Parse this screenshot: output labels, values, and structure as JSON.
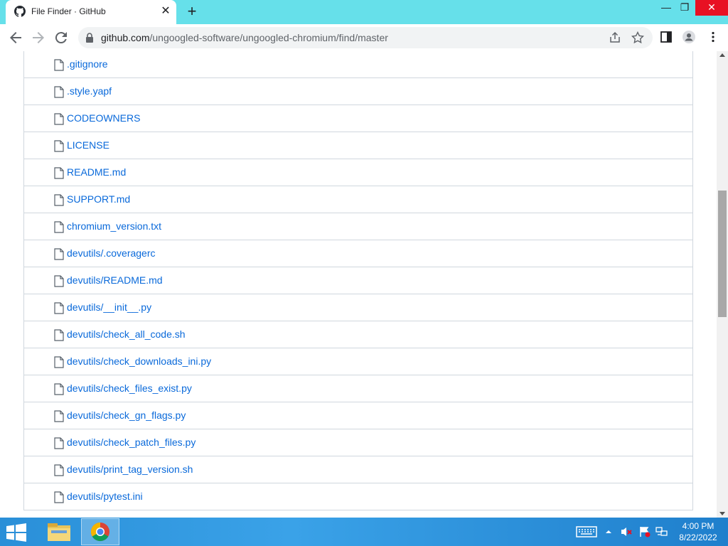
{
  "browser": {
    "tab_title": "File Finder · GitHub",
    "url_host": "github.com",
    "url_path": "/ungoogled-software/ungoogled-chromium/find/master"
  },
  "files": [
    ".gitignore",
    ".style.yapf",
    "CODEOWNERS",
    "LICENSE",
    "README.md",
    "SUPPORT.md",
    "chromium_version.txt",
    "devutils/.coveragerc",
    "devutils/README.md",
    "devutils/__init__.py",
    "devutils/check_all_code.sh",
    "devutils/check_downloads_ini.py",
    "devutils/check_files_exist.py",
    "devutils/check_gn_flags.py",
    "devutils/check_patch_files.py",
    "devutils/print_tag_version.sh",
    "devutils/pytest.ini"
  ],
  "taskbar": {
    "time": "4:00 PM",
    "date": "8/22/2022"
  },
  "colors": {
    "tabstrip": "#66e0ea",
    "link": "#0969da",
    "close_hover": "#e81123"
  }
}
